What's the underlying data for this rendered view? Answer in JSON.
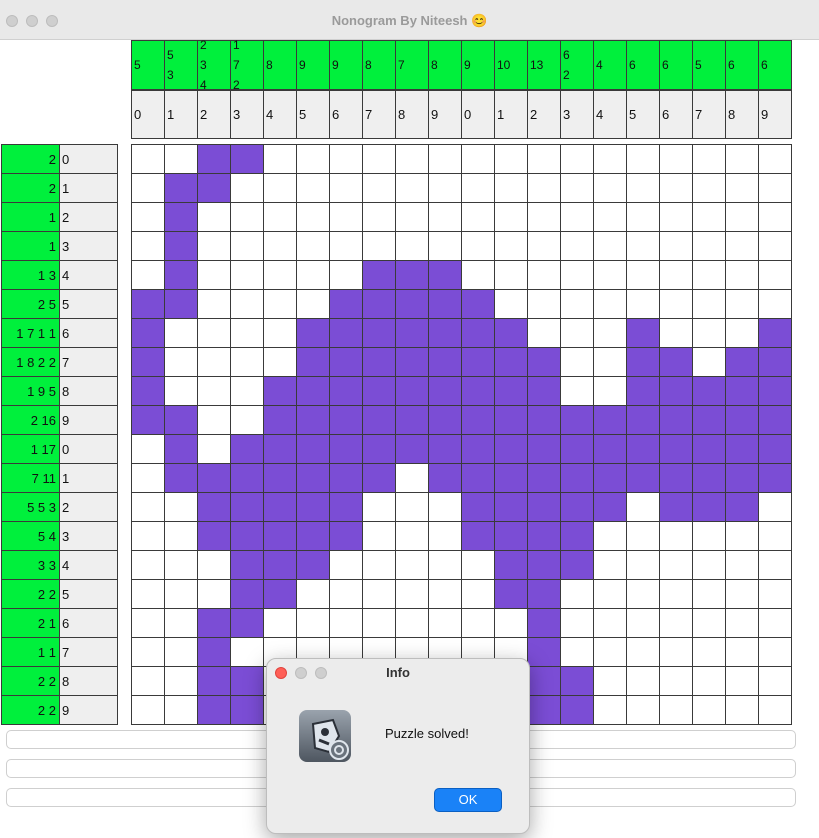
{
  "window": {
    "title": "Nonogram By Niteesh 😊"
  },
  "column_clues": [
    "5",
    "5\n3",
    "2\n3\n4",
    "1\n7\n2",
    "8",
    "9",
    "9",
    "8",
    "7",
    "8",
    "9",
    "10",
    "13",
    "6\n2",
    "4",
    "6",
    "6",
    "5",
    "6",
    "6"
  ],
  "column_indices": [
    "0",
    "1",
    "2",
    "3",
    "4",
    "5",
    "6",
    "7",
    "8",
    "9",
    "0",
    "1",
    "2",
    "3",
    "4",
    "5",
    "6",
    "7",
    "8",
    "9"
  ],
  "row_clues": [
    "2",
    "2",
    "1",
    "1",
    "1 3",
    "2 5",
    "1 7 1 1",
    "1 8 2 2",
    "1 9 5",
    "2 16",
    "1 17",
    "7 11",
    "5 5 3",
    "5 4",
    "3 3",
    "2 2",
    "2 1",
    "1 1",
    "2 2",
    "2 2"
  ],
  "row_indices": [
    "0",
    "1",
    "2",
    "3",
    "4",
    "5",
    "6",
    "7",
    "8",
    "9",
    "0",
    "1",
    "2",
    "3",
    "4",
    "5",
    "6",
    "7",
    "8",
    "9"
  ],
  "grid": [
    "00110000000000000000",
    "01100000000000000000",
    "01000000000000000000",
    "01000000000000000000",
    "01000001110000000000",
    "11000011111000000000",
    "10000111111100010001",
    "10000111111110011011",
    "10001111111110011111",
    "11001111111111111111",
    "01011111111111111111",
    "01111111011111111111",
    "00111110001111101110",
    "00111110001111000000",
    "00011100000111000000",
    "00011000000110000000",
    "00110000000010000000",
    "00100000000010000000",
    "00110000000011000000",
    "00110000000011000000"
  ],
  "bottom_bars": [
    "",
    "",
    ""
  ],
  "dialog": {
    "title": "Info",
    "message": "Puzzle solved!",
    "ok_label": "OK",
    "icon": "java-duke-app-icon"
  },
  "colors": {
    "clue_bg": "#00f03c",
    "filled": "#7b4dd5",
    "ok_button": "#1a82f7"
  }
}
